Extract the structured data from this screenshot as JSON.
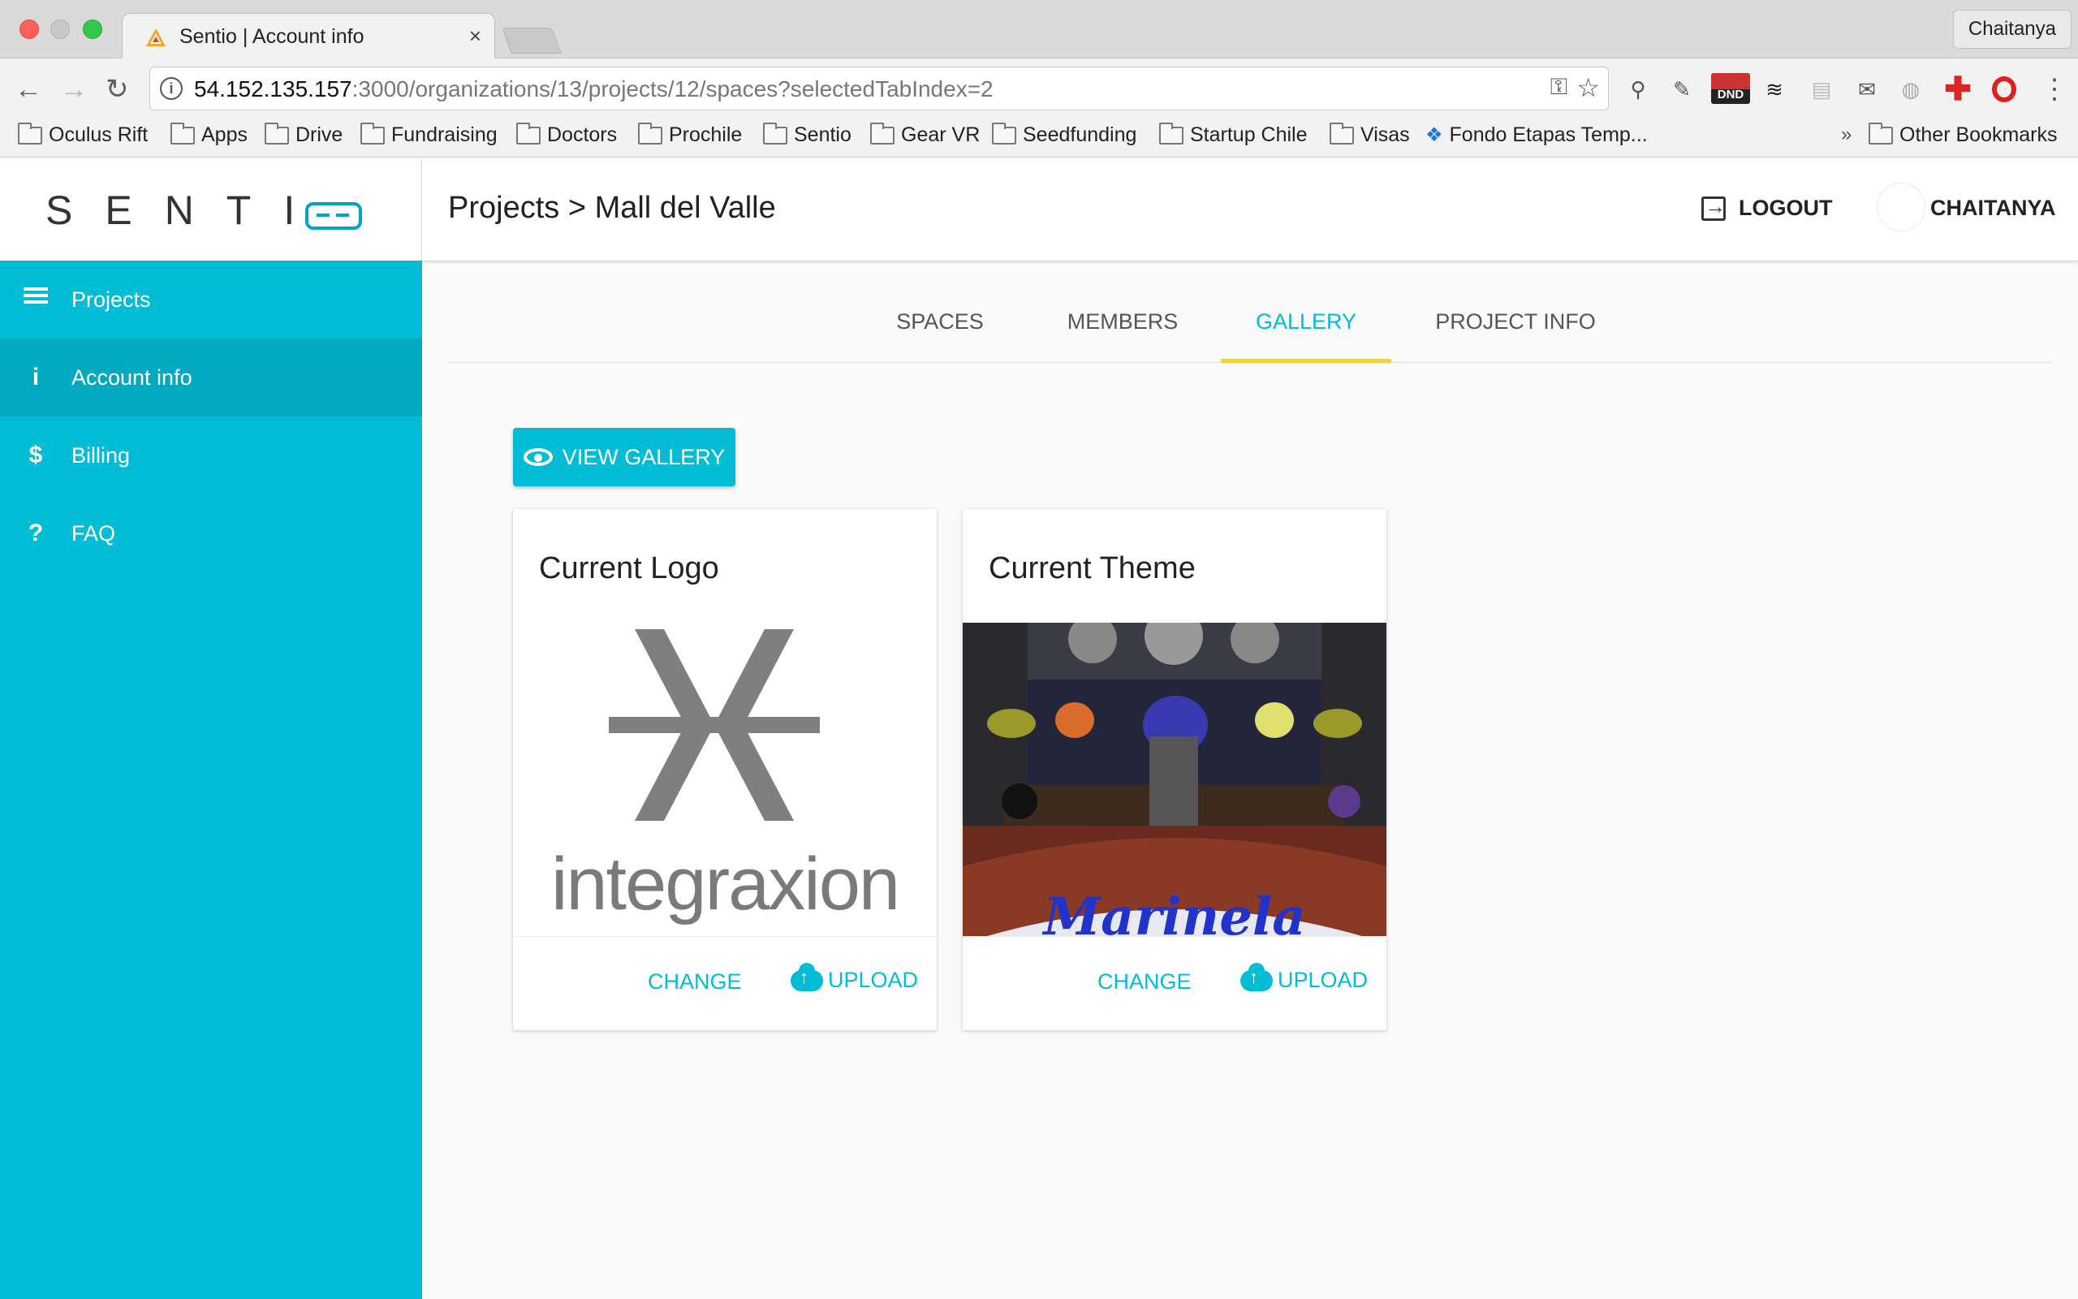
{
  "browser": {
    "tab_title": "Sentio | Account info",
    "profile": "Chaitanya",
    "url_host": "54.152.135.157",
    "url_path": ":3000/organizations/13/projects/12/spaces?selectedTabIndex=2",
    "dnd_label": "DND",
    "bookmarks": [
      "Oculus Rift",
      "Apps",
      "Drive",
      "Fundraising",
      "Doctors",
      "Prochile",
      "Sentio",
      "Gear VR",
      "Seedfunding",
      "Startup Chile",
      "Visas",
      "Fondo Etapas Temp...",
      "Other Bookmarks"
    ]
  },
  "brand": {
    "name": "SENTI"
  },
  "sidebar": {
    "items": [
      {
        "label": "Projects",
        "icon": "list-icon"
      },
      {
        "label": "Account info",
        "icon": "info-icon",
        "glyph": "i"
      },
      {
        "label": "Billing",
        "icon": "dollar-icon",
        "glyph": "$"
      },
      {
        "label": "FAQ",
        "icon": "question-icon",
        "glyph": "?"
      }
    ],
    "active_index": 1
  },
  "header": {
    "breadcrumb": "Projects > Mall del Valle",
    "logout_label": "LOGOUT",
    "user_label": "CHAITANYA"
  },
  "tabs": [
    {
      "label": "SPACES"
    },
    {
      "label": "MEMBERS"
    },
    {
      "label": "GALLERY"
    },
    {
      "label": "PROJECT INFO"
    }
  ],
  "selected_tab": "GALLERY",
  "gallery": {
    "view_label": "VIEW GALLERY",
    "cards": [
      {
        "title": "Current Logo",
        "image_text": "integraxion",
        "change_label": "CHANGE",
        "upload_label": "UPLOAD"
      },
      {
        "title": "Current Theme",
        "image_text": "Marinela",
        "change_label": "CHANGE",
        "upload_label": "UPLOAD"
      }
    ]
  },
  "colors": {
    "accent": "#00bcd4",
    "sidebar_active": "#00a8c0",
    "tab_indicator": "#f4d03f"
  }
}
